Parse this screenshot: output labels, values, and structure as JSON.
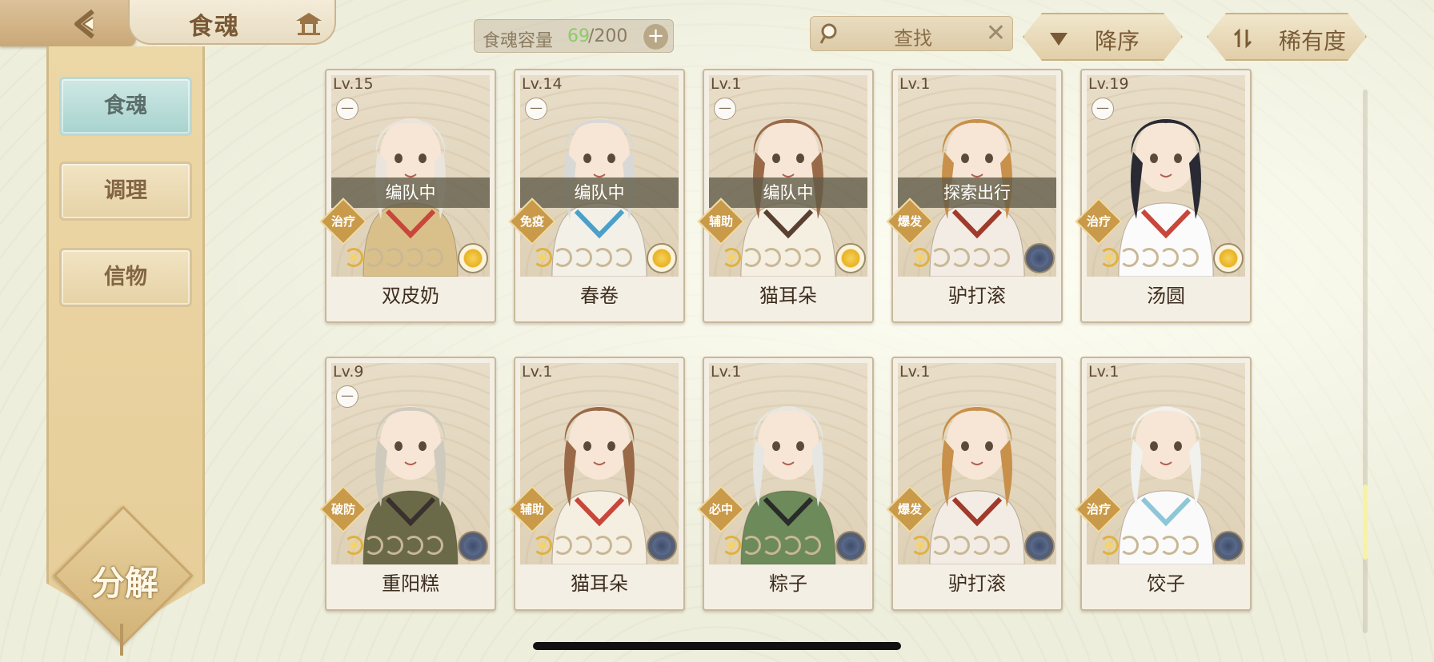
{
  "header": {
    "back_icon": "back-arrow-icon",
    "title": "食魂",
    "home_icon": "pavilion-home-icon",
    "capacity": {
      "label": "食魂容量",
      "current": "69",
      "max": "/200",
      "plus": "+"
    },
    "search": {
      "text": "查找",
      "clear": "✕"
    },
    "sort_order": {
      "label": "降序",
      "icon": "triangle-down-icon"
    },
    "sort_key": {
      "label": "稀有度",
      "icon": "sort-arrows-icon"
    }
  },
  "sidebar": {
    "tabs": [
      {
        "label": "食魂",
        "active": true
      },
      {
        "label": "调理",
        "active": false
      },
      {
        "label": "信物",
        "active": false
      }
    ],
    "decompose_label": "分解"
  },
  "cards": [
    {
      "level": "Lv.15",
      "name": "双皮奶",
      "role": "治疗",
      "status": "编队中",
      "stars": 1,
      "rarity": "gold",
      "locked": true,
      "palette": [
        "#e9e4dc",
        "#d9c08a",
        "#c9463a"
      ]
    },
    {
      "level": "Lv.14",
      "name": "春卷",
      "role": "免疫",
      "status": "编队中",
      "stars": 1,
      "rarity": "gold",
      "locked": true,
      "palette": [
        "#d8d8d6",
        "#f3f0e8",
        "#4aa0c8"
      ]
    },
    {
      "level": "Lv.1",
      "name": "猫耳朵",
      "role": "辅助",
      "status": "编队中",
      "stars": 1,
      "rarity": "gold",
      "locked": true,
      "palette": [
        "#9a6a48",
        "#f5efe2",
        "#5a4030"
      ]
    },
    {
      "level": "Lv.1",
      "name": "驴打滚",
      "role": "爆发",
      "status": "探索出行",
      "stars": 1,
      "rarity": "blue",
      "locked": false,
      "palette": [
        "#c8904a",
        "#f2ece4",
        "#a03a2a"
      ]
    },
    {
      "level": "Lv.19",
      "name": "汤圆",
      "role": "治疗",
      "status": "",
      "stars": 1,
      "rarity": "gold",
      "locked": true,
      "palette": [
        "#2a2a34",
        "#fbfbfb",
        "#c8463a"
      ]
    },
    {
      "level": "Lv.9",
      "name": "重阳糕",
      "role": "破防",
      "status": "",
      "stars": 1,
      "rarity": "blue",
      "locked": true,
      "palette": [
        "#cfcabe",
        "#6a6a48",
        "#3a3030"
      ]
    },
    {
      "level": "Lv.1",
      "name": "猫耳朵",
      "role": "辅助",
      "status": "",
      "stars": 1,
      "rarity": "blue",
      "locked": false,
      "palette": [
        "#9a6a48",
        "#f5efe2",
        "#c8463a"
      ]
    },
    {
      "level": "Lv.1",
      "name": "粽子",
      "role": "必中",
      "status": "",
      "stars": 1,
      "rarity": "blue",
      "locked": false,
      "palette": [
        "#e6e6e2",
        "#6c8a5a",
        "#2a2a2a"
      ]
    },
    {
      "level": "Lv.1",
      "name": "驴打滚",
      "role": "爆发",
      "status": "",
      "stars": 1,
      "rarity": "blue",
      "locked": false,
      "palette": [
        "#c8904a",
        "#f2ece4",
        "#a03a2a"
      ]
    },
    {
      "level": "Lv.1",
      "name": "饺子",
      "role": "治疗",
      "status": "",
      "stars": 1,
      "rarity": "blue",
      "locked": false,
      "palette": [
        "#f1f1ee",
        "#fafafa",
        "#8ec6d8"
      ]
    }
  ]
}
